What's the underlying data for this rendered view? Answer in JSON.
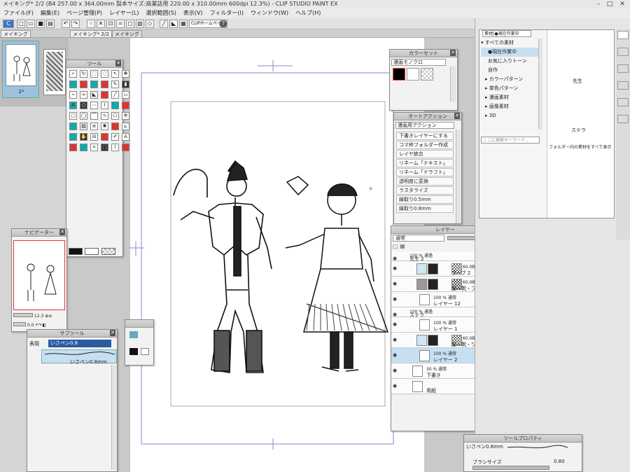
{
  "window": {
    "title": "メイキング* 2/2 (B4 257.00 x 364.00mm 製本サイズ:商業誌用 220.00 x 310.00mm 600dpi 12.3%) - CLIP STUDIO PAINT EX",
    "min": "–",
    "max": "□",
    "close": "✕"
  },
  "menu": [
    "ファイル(F)",
    "編集(E)",
    "ページ管理(P)",
    "レイヤー(L)",
    "選択範囲(S)",
    "表示(V)",
    "フィルター(I)",
    "ウィンドウ(W)",
    "ヘルプ(H)"
  ],
  "toolbar": {
    "clip_label": "CLIPホームページ",
    "help": "?"
  },
  "tabs": {
    "left_tab": "メイキング",
    "tab1": "メイキング* 2/2",
    "tab2": "メイキング"
  },
  "pages": {
    "page_label": "2*"
  },
  "tool_panel": {
    "title": "ツール"
  },
  "navigator": {
    "title": "ナビゲーター",
    "zoom": "12.3",
    "angle": "0.0"
  },
  "subtool": {
    "title": "サブツール",
    "tab_label": "いさペン0.8",
    "tab2": "表現",
    "item_label": "いさペン0.8mm"
  },
  "colorset": {
    "title": "カラーセット",
    "set_name": "漫画モノクロ"
  },
  "autoaction": {
    "title": "オートアクション",
    "set_name": "漫画用アクション",
    "items": [
      "下書きレイヤーにする",
      "コマ枠フォルダー作成",
      "レイヤ統合",
      "リネーム「テキスト」",
      "リネーム「ドラフト」",
      "透明度に変換",
      "ラスタライズ",
      "線取り0.5mm",
      "線取り0.8mm"
    ]
  },
  "layers": {
    "title": "レイヤー",
    "blend": "通常",
    "opacity": "100",
    "rows": [
      {
        "l1": "100 % 通過",
        "l2": "先生 2"
      },
      {
        "l1": "60.0線 20K 円",
        "l2": "ラーブ 2"
      },
      {
        "l1": "60.0線 50K 円",
        "l2": "服・靴・ブーツ 2"
      },
      {
        "l1": "100 % 通常",
        "l2": "レイヤー 12"
      },
      {
        "l1": "100 % 通過",
        "l2": "ステラ"
      },
      {
        "l1": "100 % 通常",
        "l2": "レイヤー 1"
      },
      {
        "l1": "60.0線 20K 円",
        "l2": "服・靴・ワンピース"
      },
      {
        "l1": "100 % 通常",
        "l2": "レイヤー 2"
      },
      {
        "l1": "30 % 通常",
        "l2": "下書き"
      },
      {
        "l1": "",
        "l2": "用紙"
      }
    ]
  },
  "material": {
    "tab": "素材[●現在作業中",
    "tree": [
      "すべての素材",
      "●現在作業中",
      "お気に入りトーン",
      "自作",
      "カラーパターン",
      "単色パターン",
      "漫画素材",
      "画像素材",
      "3D"
    ],
    "search_placeholder": "ここに検索キーワード…",
    "items": [
      "先生",
      "ステラ",
      "フォルダー内の素材をすべて表示"
    ]
  },
  "toolprop": {
    "title": "ツールプロパティ",
    "brush_name": "いさペン0.8mm",
    "size_label": "ブラシサイズ",
    "size_value": "0.80"
  }
}
